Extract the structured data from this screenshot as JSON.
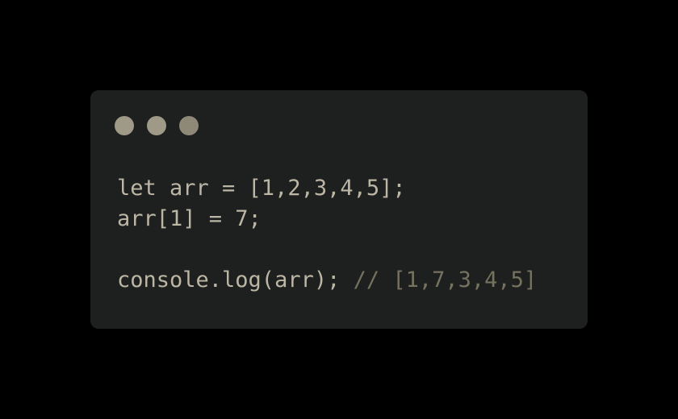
{
  "colors": {
    "background": "#000000",
    "window": "#1e1f1f",
    "window_dot": "#9f9987",
    "code_text": "#bcb6a5",
    "comment_text": "#75725f"
  },
  "window": {
    "controls": [
      "window-dot",
      "window-dot",
      "window-dot"
    ]
  },
  "code": {
    "line1": "let arr = [1,2,3,4,5];",
    "line2": "arr[1] = 7;",
    "line3": "",
    "line4_code": "console.log(arr); ",
    "line4_comment": "// [1,7,3,4,5]"
  }
}
